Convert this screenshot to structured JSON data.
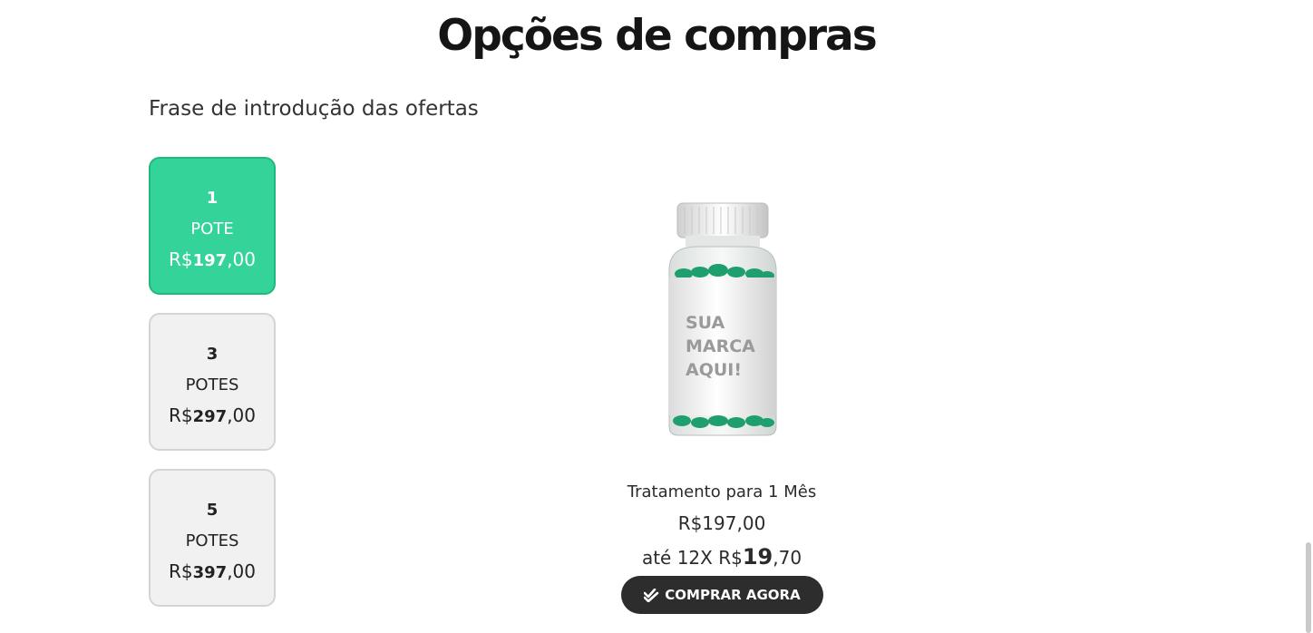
{
  "section": {
    "title": "Opções de compras",
    "intro": "Frase de introdução das ofertas"
  },
  "options": [
    {
      "qty": "1",
      "unit": "POTE",
      "currency": "R$",
      "price_main": "197",
      "price_cents": ",00",
      "selected": true
    },
    {
      "qty": "3",
      "unit": "POTES",
      "currency": "R$",
      "price_main": "297",
      "price_cents": ",00",
      "selected": false
    },
    {
      "qty": "5",
      "unit": "POTES",
      "currency": "R$",
      "price_main": "397",
      "price_cents": ",00",
      "selected": false
    }
  ],
  "product": {
    "label_text": [
      "SUA",
      "MARCA",
      "AQUI!"
    ],
    "name": "Tratamento para 1 Mês",
    "price": "R$197,00",
    "installment_prefix": "até 12X R$",
    "installment_main": "19",
    "installment_cents": ",70",
    "buy_label": "COMPRAR AGORA",
    "buy_icon": "double-check-icon"
  },
  "colors": {
    "selected_bg": "#34d399",
    "selected_border": "#20b97c",
    "option_bg": "#f1f1f1",
    "button_bg": "#2d2d2d",
    "capsule": "#1f9e6e"
  }
}
